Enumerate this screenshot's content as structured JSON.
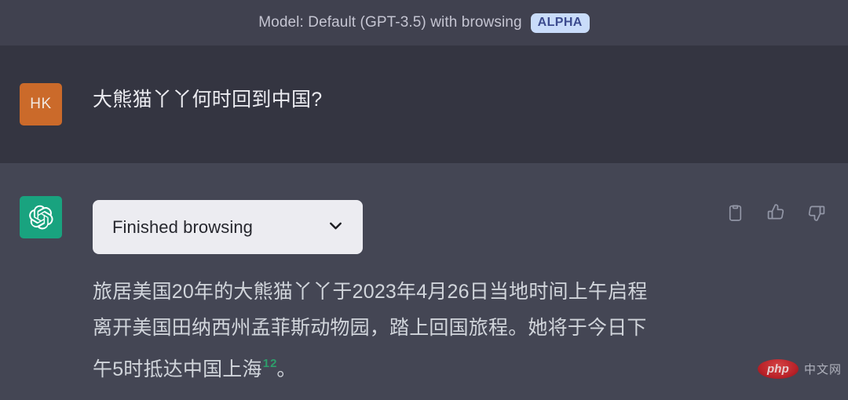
{
  "header": {
    "model_text": "Model: Default (GPT-3.5) with browsing",
    "badge_label": "ALPHA",
    "background_color": "#40414F",
    "text_color": "#C5C5D2",
    "badge_background": "#C9DCFA",
    "badge_text_color": "#3C4B8E"
  },
  "conversation": {
    "user_message": {
      "avatar_initials": "HK",
      "avatar_color": "#CB6A2A",
      "text": "大熊猫丫丫何时回到中国?",
      "row_background": "#343541"
    },
    "assistant_message": {
      "avatar_icon": "openai-logo-icon",
      "avatar_color": "#19A37F",
      "row_background": "#444654",
      "browsing_panel": {
        "label": "Finished browsing",
        "chevron_icon": "chevron-down-icon",
        "background": "#ECECF1",
        "text_color": "#26272E"
      },
      "answer_lines": [
        "旅居美国20年的大熊猫丫丫于2023年4月26日当地时间上午启程",
        "离开美国田纳西州孟菲斯动物园，踏上回国旅程。她将于今日下",
        "午5时抵达中国上海"
      ],
      "answer_citations": [
        "1",
        "2"
      ],
      "answer_citation_color": "#2E9E6B",
      "answer_tail": "。",
      "actions": [
        {
          "name": "copy-icon",
          "label": "Copy"
        },
        {
          "name": "thumbs-up-icon",
          "label": "Good response"
        },
        {
          "name": "thumbs-down-icon",
          "label": "Bad response"
        }
      ]
    }
  },
  "watermark": {
    "logo_text": "php",
    "site_text": "中文网"
  }
}
